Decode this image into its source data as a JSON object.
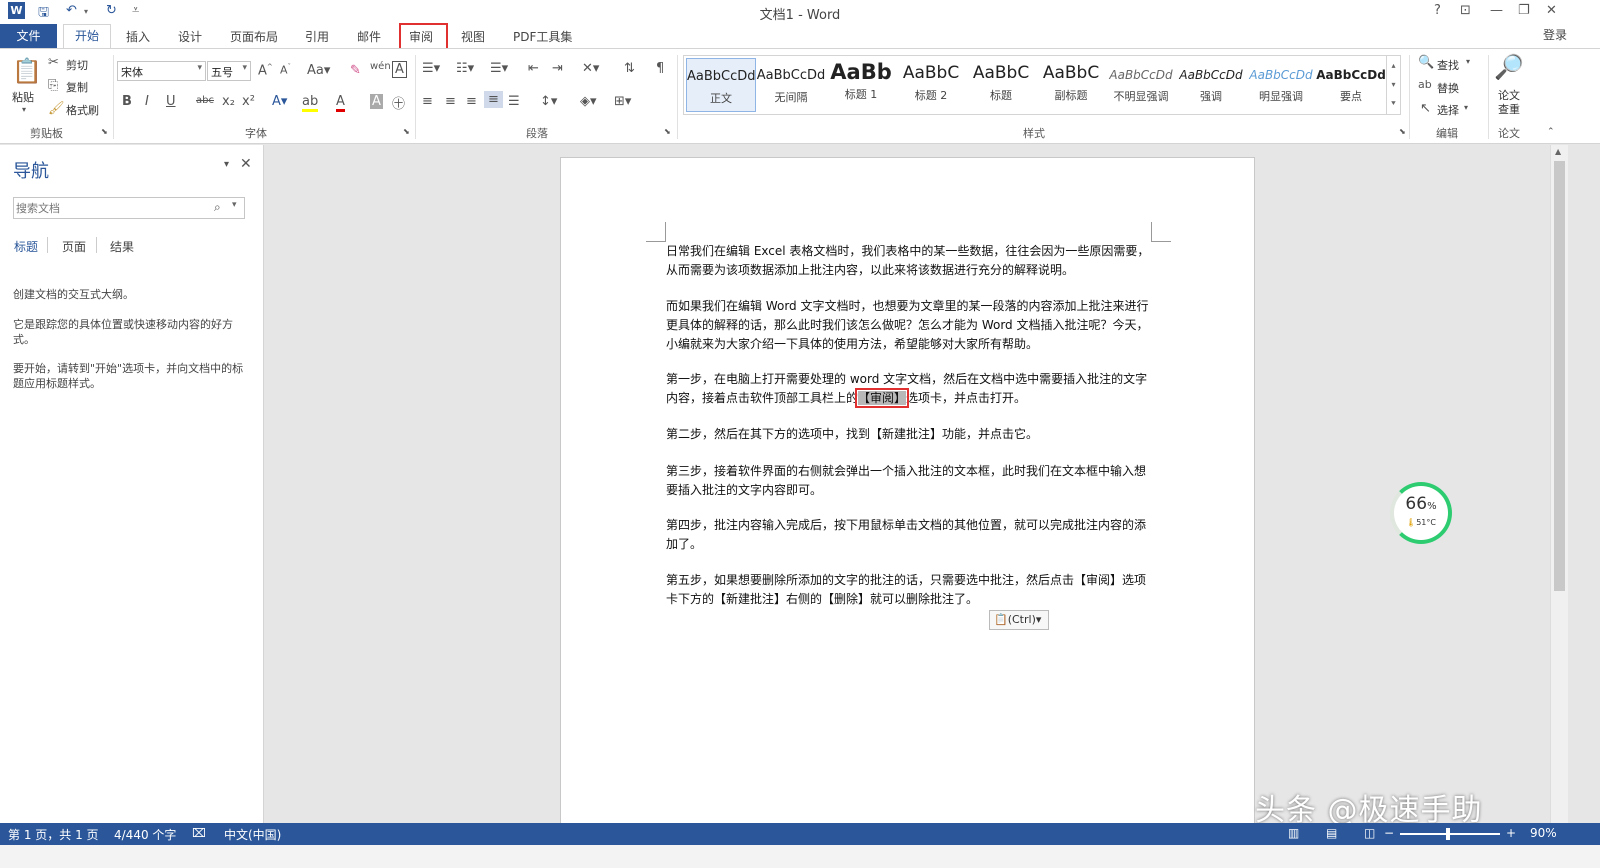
{
  "window": {
    "title": "文档1 - Word",
    "help": "?",
    "login": "登录"
  },
  "tabs": [
    "文件",
    "开始",
    "插入",
    "设计",
    "页面布局",
    "引用",
    "邮件",
    "审阅",
    "视图",
    "PDF工具集"
  ],
  "clipboard": {
    "paste": "粘贴",
    "cut": "剪切",
    "copy": "复制",
    "format_painter": "格式刷",
    "label": "剪贴板"
  },
  "font": {
    "name": "宋体",
    "size": "五号",
    "label": "字体"
  },
  "paragraph": {
    "label": "段落"
  },
  "styles": {
    "label": "样式",
    "items": [
      {
        "preview": "AaBbCcDd",
        "name": "正文"
      },
      {
        "preview": "AaBbCcDd",
        "name": "无间隔"
      },
      {
        "preview": "AaBb",
        "name": "标题 1"
      },
      {
        "preview": "AaBbC",
        "name": "标题 2"
      },
      {
        "preview": "AaBbC",
        "name": "标题"
      },
      {
        "preview": "AaBbC",
        "name": "副标题"
      },
      {
        "preview": "AaBbCcDd",
        "name": "不明显强调"
      },
      {
        "preview": "AaBbCcDd",
        "name": "强调"
      },
      {
        "preview": "AaBbCcDd",
        "name": "明显强调"
      },
      {
        "preview": "AaBbCcDd",
        "name": "要点"
      }
    ]
  },
  "editing": {
    "find": "查找",
    "replace": "替换",
    "select": "选择",
    "label": "编辑"
  },
  "paper": {
    "check": "论文查重",
    "label": "论文"
  },
  "nav": {
    "title": "导航",
    "search_placeholder": "搜索文档",
    "tabs": [
      "标题",
      "页面",
      "结果"
    ],
    "text1": "创建文档的交互式大纲。",
    "text2": "它是跟踪您的具体位置或快速移动内容的好方式。",
    "text3": "要开始，请转到\"开始\"选项卡，并向文档中的标题应用标题样式。"
  },
  "document": {
    "paragraphs": [
      "日常我们在编辑 Excel 表格文档时，我们表格中的某一些数据，往往会因为一些原因需要，从而需要为该项数据添加上批注内容，以此来将该数据进行充分的解释说明。",
      "而如果我们在编辑 Word 文字文档时，也想要为文章里的某一段落的内容添加上批注来进行更具体的解释的话，那么此时我们该怎么做呢？怎么才能为 Word 文档插入批注呢？今天，小编就来为大家介绍一下具体的使用方法，希望能够对大家所有帮助。",
      "",
      "第二步，然后在其下方的选项中，找到【新建批注】功能，并点击它。",
      "第三步，接着软件界面的右侧就会弹出一个插入批注的文本框，此时我们在文本框中输入想要插入批注的文字内容即可。",
      "第四步，批注内容输入完成后，按下用鼠标单击文档的其他位置，就可以完成批注内容的添加了。",
      "第五步，如果想要删除所添加的文字的批注的话，只需要选中批注，然后点击【审阅】选项卡下方的【新建批注】右侧的【删除】就可以删除批注了。"
    ],
    "step1_a": "第一步，在电脑上打开需要处理的 word 文字文档，然后在文档中选中需要插入批注的文字内容，接着点击软件顶部工具栏上的",
    "step1_hl": "【审阅】",
    "step1_b": "选项卡，并点击打开。",
    "paste_tag": "(Ctrl)"
  },
  "widget": {
    "percent": "66",
    "unit": "%",
    "temp": "51°C"
  },
  "watermark": "头条 @极速手助",
  "status": {
    "page": "第 1 页，共 1 页",
    "words": "4/440 个字",
    "lang": "中文(中国)",
    "zoom": "90%"
  }
}
